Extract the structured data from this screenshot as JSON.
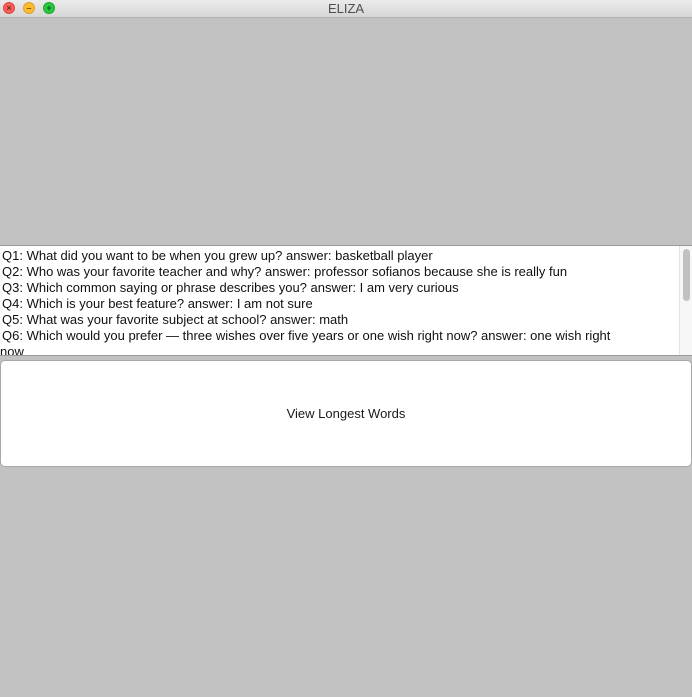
{
  "window": {
    "title": "ELIZA",
    "controls": {
      "close_glyph": "×",
      "minimize_glyph": "–",
      "maximize_glyph": "+"
    }
  },
  "transcript": {
    "lines": [
      "Q1: What did you want to be when you grew up? answer:  basketball player",
      "Q2: Who was your favorite teacher and why? answer:  professor sofianos because she is really fun",
      "Q3: Which common saying or phrase describes you? answer:  I am very curious",
      "Q4: Which is your best feature? answer:  I am not sure",
      "Q5: What was your favorite subject at school? answer:  math",
      "Q6: Which would you prefer — three wishes over five years or one wish right now? answer:  one wish right",
      "now"
    ]
  },
  "button": {
    "label": "View Longest Words"
  },
  "colors": {
    "background": "#c2c2c2",
    "close": "#fc5f57",
    "minimize": "#fdbc2e",
    "maximize": "#28c840"
  }
}
